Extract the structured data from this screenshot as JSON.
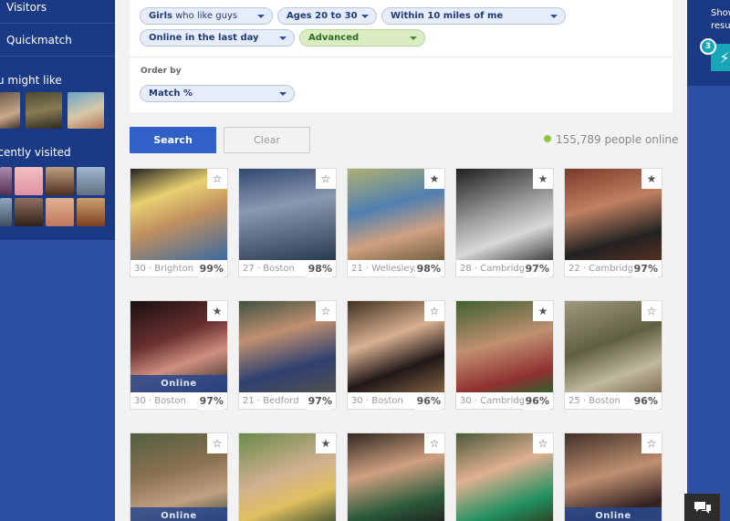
{
  "sidebar": {
    "nav": [
      {
        "label": "Visitors"
      },
      {
        "label": "Quickmatch"
      }
    ],
    "might_like_heading": "u might like",
    "recently_visited_heading": "ecently visited"
  },
  "filters": {
    "gender": {
      "bold": "Girls",
      "light": " who like guys"
    },
    "age": "Ages 20 to 30",
    "distance": "Within 10 miles of me",
    "activity": "Online in the last day",
    "advanced": "Advanced",
    "order_by_label": "Order by",
    "order_by_value": "Match %"
  },
  "actions": {
    "search_label": "Search",
    "clear_label": "Clear"
  },
  "online": {
    "count_text": "155,789 people online",
    "dot_color": "#8dc63f"
  },
  "cards": [
    {
      "info": "30 · Brighton",
      "match": "99%",
      "online": false,
      "starred": false
    },
    {
      "info": "27 · Boston",
      "match": "98%",
      "online": false,
      "starred": false
    },
    {
      "info": "21 · Wellesley...",
      "match": "98%",
      "online": false,
      "starred": true
    },
    {
      "info": "28 · Cambridge",
      "match": "97%",
      "online": false,
      "starred": true
    },
    {
      "info": "22 · Cambridge",
      "match": "97%",
      "online": false,
      "starred": true
    },
    {
      "info": "30 · Boston",
      "match": "97%",
      "online": true,
      "starred": true
    },
    {
      "info": "21 · Bedford",
      "match": "97%",
      "online": false,
      "starred": false
    },
    {
      "info": "30 · Boston",
      "match": "96%",
      "online": false,
      "starred": false
    },
    {
      "info": "30 · Cambridge",
      "match": "96%",
      "online": false,
      "starred": true
    },
    {
      "info": "25 · Boston",
      "match": "96%",
      "online": false,
      "starred": false
    },
    {
      "info": "",
      "match": "",
      "online": true,
      "starred": false
    },
    {
      "info": "",
      "match": "",
      "online": false,
      "starred": true
    },
    {
      "info": "",
      "match": "",
      "online": false,
      "starred": false
    },
    {
      "info": "",
      "match": "",
      "online": false,
      "starred": false
    },
    {
      "info": "",
      "match": "",
      "online": true,
      "starred": false
    }
  ],
  "online_label": "Online",
  "right_panel": {
    "show_text_line1": "Show",
    "show_text_line2": "resu",
    "badge_count": "3"
  },
  "colors": {
    "accent": "#3060c8",
    "sidebar": "#1a3a86",
    "boost": "#17a5b8"
  }
}
